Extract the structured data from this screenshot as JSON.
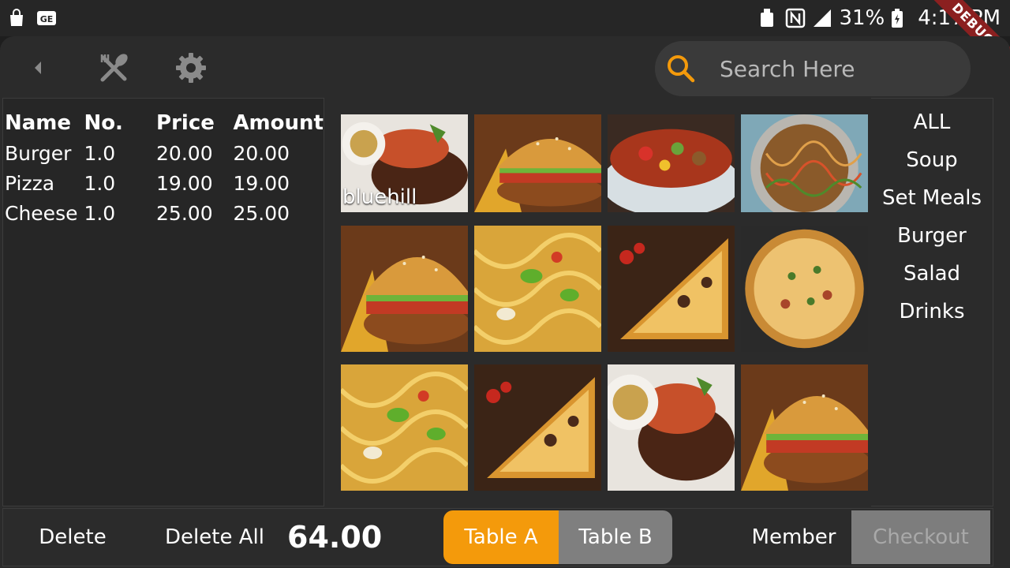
{
  "status_bar": {
    "battery": "31%",
    "time": "4:17 PM",
    "debug_banner": "DEBUG",
    "left_icons": [
      "shopping-bag-icon",
      "ge-icon"
    ],
    "right_icons": [
      "usb-icon",
      "nfc-icon",
      "signal-icon",
      "battery-charging-icon"
    ]
  },
  "toolbar": {
    "search_placeholder": "Search Here",
    "icons": [
      "back-icon",
      "utensils-icon",
      "settings-icon"
    ],
    "accent_color": "#f49a0b"
  },
  "order": {
    "columns": [
      "Name",
      "No.",
      "Price",
      "Amount"
    ],
    "rows": [
      {
        "name": "Burger",
        "qty": "1.0",
        "price": "20.00",
        "amount": "20.00"
      },
      {
        "name": "Pizza",
        "qty": "1.0",
        "price": "19.00",
        "amount": "19.00"
      },
      {
        "name": "Cheese",
        "qty": "1.0",
        "price": "25.00",
        "amount": "25.00"
      }
    ]
  },
  "products": [
    {
      "kind": "steak",
      "label": "bluehill"
    },
    {
      "kind": "burger"
    },
    {
      "kind": "stirfry"
    },
    {
      "kind": "noodles"
    },
    {
      "kind": "burger"
    },
    {
      "kind": "pasta"
    },
    {
      "kind": "pizza-slice"
    },
    {
      "kind": "pizza-whole"
    },
    {
      "kind": "pasta"
    },
    {
      "kind": "pizza-slice"
    },
    {
      "kind": "steak"
    },
    {
      "kind": "burger"
    }
  ],
  "categories": [
    "ALL",
    "Soup",
    "Set Meals",
    "Burger",
    "Salad",
    "Drinks"
  ],
  "bottom": {
    "delete": "Delete",
    "delete_all": "Delete All",
    "total": "64.00",
    "table_a": "Table A",
    "table_b": "Table B",
    "member": "Member",
    "checkout": "Checkout"
  }
}
